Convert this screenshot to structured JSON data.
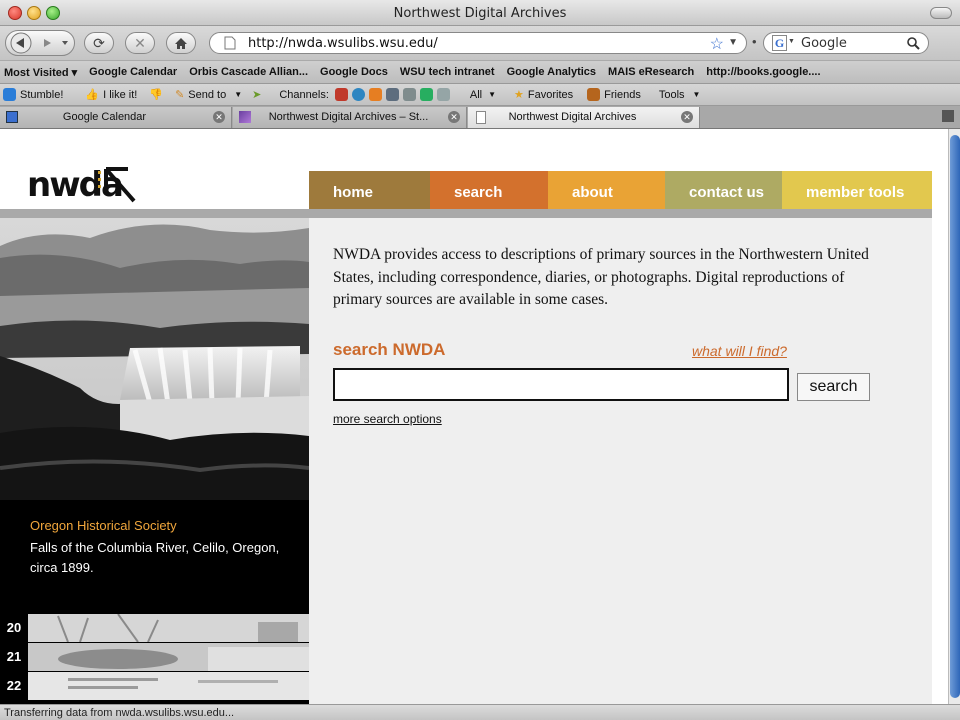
{
  "window": {
    "title": "Northwest Digital Archives"
  },
  "toolbar": {
    "url": "http://nwda.wsulibs.wsu.edu/",
    "search_placeholder": "Google"
  },
  "bookmarks": [
    "Most Visited ▾",
    "Google Calendar",
    "Orbis Cascade Allian...",
    "Google Docs",
    "WSU tech intranet",
    "Google Analytics",
    "MAIS eResearch",
    "http://books.google...."
  ],
  "stumble_bar": {
    "stumble": "Stumble!",
    "like": "I like it!",
    "send": "Send to",
    "channels": "Channels:",
    "all": "All",
    "favorites": "Favorites",
    "friends": "Friends",
    "tools": "Tools"
  },
  "tabs": [
    {
      "title": "Google Calendar"
    },
    {
      "title": "Northwest Digital Archives – St..."
    },
    {
      "title": "Northwest Digital Archives"
    }
  ],
  "site": {
    "logo": "nwda",
    "nav": [
      {
        "label": "home",
        "color": "#9e7a3c"
      },
      {
        "label": "search",
        "color": "#d3712d"
      },
      {
        "label": "about",
        "color": "#e9a335"
      },
      {
        "label": "contact us",
        "color": "#aeaa63"
      },
      {
        "label": "member tools",
        "color": "#e2c84e"
      }
    ],
    "intro": "NWDA provides access to descriptions of primary sources in the Northwestern United States, including correspondence, diaries, or photographs. Digital reproductions of primary sources are available in some cases.",
    "search_title": "search NWDA",
    "what_link": "what will I find?",
    "search_button": "search",
    "more_options": "more search options",
    "caption": {
      "org": "Oregon Historical Society",
      "description": "Falls of the Columbia River, Celilo, Oregon, circa 1899."
    },
    "strips": [
      "20",
      "21",
      "22"
    ]
  },
  "status": {
    "text": "Transferring data from nwda.wsulibs.wsu.edu..."
  },
  "colors": {
    "accent": "#cc6a2c",
    "caption_org": "#f0a63c"
  }
}
